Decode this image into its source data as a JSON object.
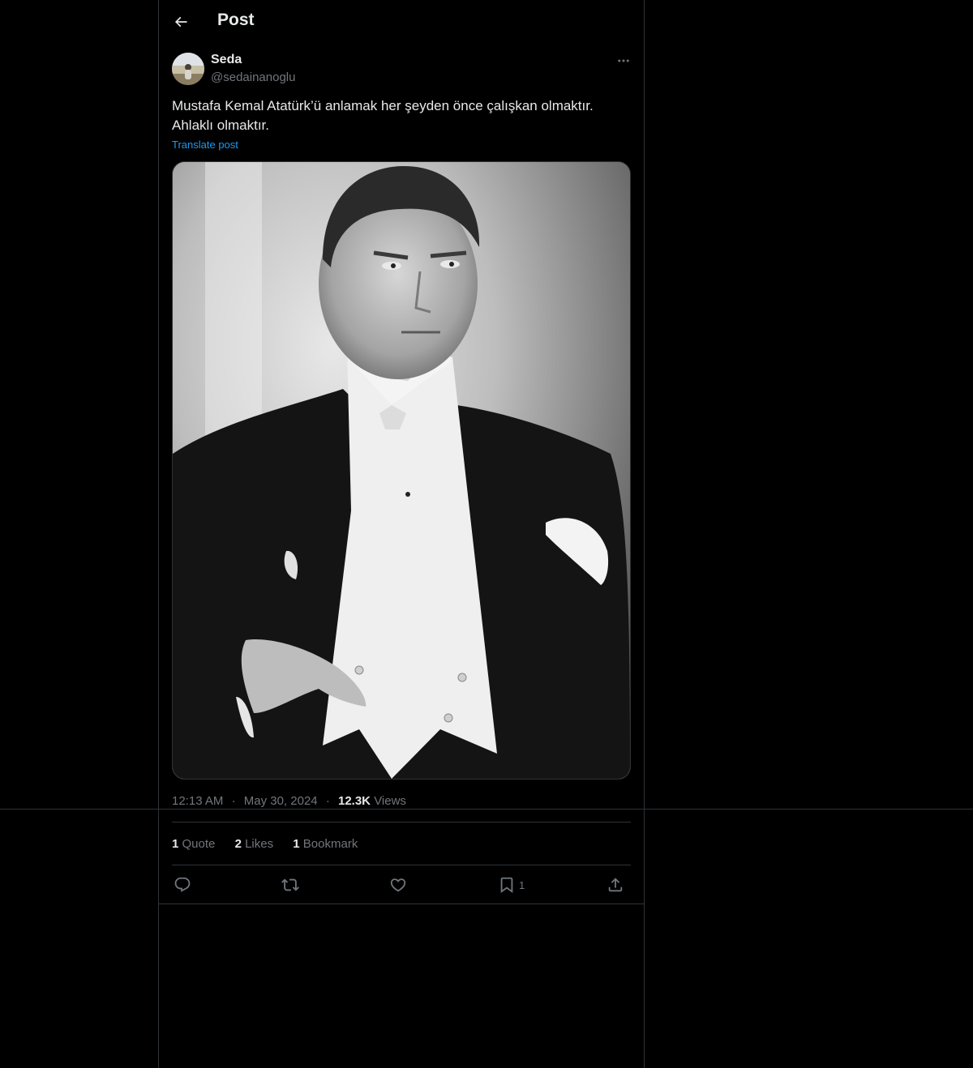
{
  "header": {
    "title": "Post"
  },
  "author": {
    "display_name": "Seda",
    "handle": "@sedainanoglu"
  },
  "post": {
    "text_line1": "Mustafa Kemal Atatürk’ü anlamak her şeyden önce çalışkan olmaktır.",
    "text_line2": "Ahlaklı olmaktır.",
    "translate_label": "Translate post",
    "time": "12:13 AM",
    "separator": "·",
    "date": "May 30, 2024",
    "views_count": "12.3K",
    "views_label": "Views"
  },
  "stats": {
    "quotes_count": "1",
    "quotes_label": "Quote",
    "likes_count": "2",
    "likes_label": "Likes",
    "bookmarks_count": "1",
    "bookmarks_label": "Bookmark"
  },
  "actions": {
    "bookmark_count": "1",
    "icons": [
      "reply-icon",
      "repost-icon",
      "like-icon",
      "bookmark-icon",
      "share-icon"
    ]
  },
  "colors": {
    "background": "#000000",
    "border": "#2f3336",
    "text_primary": "#e7e9ea",
    "text_secondary": "#71767b",
    "link": "#1d9bf0"
  }
}
